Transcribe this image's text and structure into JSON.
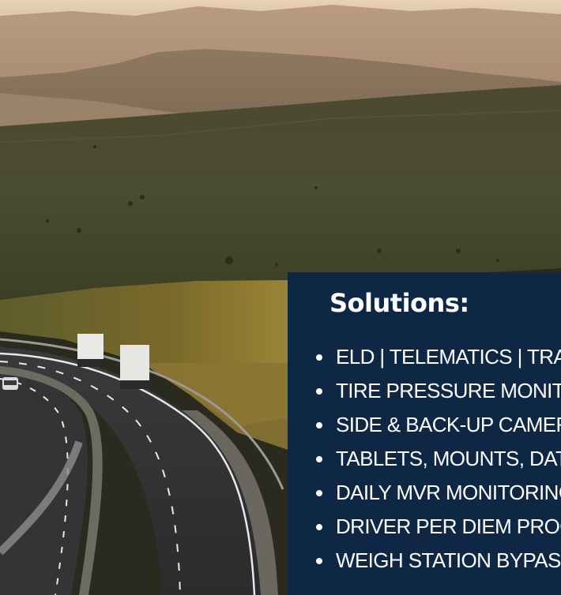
{
  "solutions": {
    "title": "Solutions:",
    "items": [
      "ELD | TELEMATICS | TRAC",
      "TIRE PRESSURE MONITOR",
      "SIDE & BACK-UP CAMERA",
      "TABLETS, MOUNTS, DATA,",
      "DAILY MVR MONITORING",
      "DRIVER PER DIEM PROGRA",
      "WEIGH STATION BYPASS"
    ]
  }
}
